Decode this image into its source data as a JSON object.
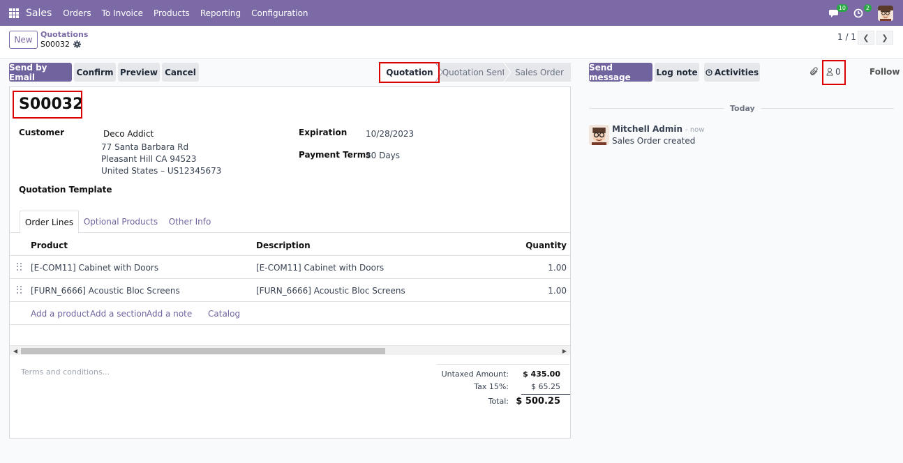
{
  "navbar": {
    "brand": "Sales",
    "menu": [
      "Orders",
      "To Invoice",
      "Products",
      "Reporting",
      "Configuration"
    ],
    "messages_badge": "10",
    "activities_badge": "2",
    "color": "#7c6aa6"
  },
  "control_panel": {
    "new_label": "New",
    "breadcrumb_parent": "Quotations",
    "breadcrumb_current": "S00032",
    "pager_value": "1 / 1"
  },
  "actions": {
    "send_by_email": "Send by Email",
    "confirm": "Confirm",
    "preview": "Preview",
    "cancel": "Cancel"
  },
  "statusbar": {
    "steps": [
      "Quotation",
      "Quotation Sent",
      "Sales Order"
    ],
    "active": "Quotation"
  },
  "form": {
    "order_name": "S00032",
    "customer_label": "Customer",
    "customer_name": "Deco Addict",
    "customer_address": [
      "77 Santa Barbara Rd",
      "Pleasant Hill CA 94523",
      "United States – US12345673"
    ],
    "quotation_template_label": "Quotation Template",
    "expiration_label": "Expiration",
    "expiration_value": "10/28/2023",
    "payment_terms_label": "Payment Terms",
    "payment_terms_value": "30 Days"
  },
  "tabs": [
    "Order Lines",
    "Optional Products",
    "Other Info"
  ],
  "order_lines": {
    "headers": [
      "Product",
      "Description",
      "Quantity"
    ],
    "rows": [
      {
        "product": "[E-COM11] Cabinet with Doors",
        "description": "[E-COM11] Cabinet with Doors",
        "quantity": "1.00"
      },
      {
        "product": "[FURN_6666] Acoustic Bloc Screens",
        "description": "[FURN_6666] Acoustic Bloc Screens",
        "quantity": "1.00"
      }
    ],
    "add_links": [
      "Add a product",
      "Add a section",
      "Add a note",
      "Catalog"
    ]
  },
  "terms_placeholder": "Terms and conditions...",
  "totals": {
    "untaxed_label": "Untaxed Amount:",
    "untaxed_value": "$ 435.00",
    "tax_label": "Tax 15%:",
    "tax_value": "$ 65.25",
    "total_label": "Total:",
    "total_value": "$ 500.25"
  },
  "chatter": {
    "send_message": "Send message",
    "log_note": "Log note",
    "activities": "Activities",
    "followers_count": "0",
    "follow": "Follow",
    "separator": "Today",
    "message": {
      "author": "Mitchell Admin",
      "time": "- now",
      "body": "Sales Order created"
    }
  }
}
